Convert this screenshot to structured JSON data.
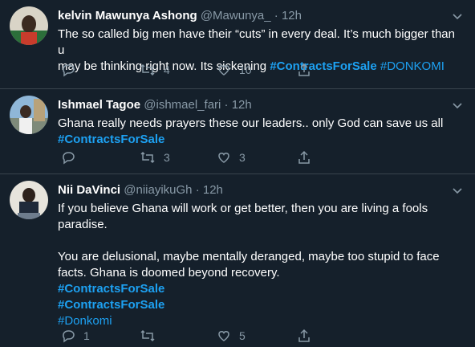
{
  "tweets": [
    {
      "name": "kelvin Mawunya Ashong",
      "handle": "@Mawunya_",
      "sep": "·",
      "time": "12h",
      "line1": "The so called big men have their “cuts” in every deal. It’s much bigger than u",
      "line2_text": "may be thinking right now. Its sickening ",
      "tag1": "#ContractsForSale",
      "tag2": "#DONKOMI",
      "replies": "",
      "retweets": "4",
      "likes": "10"
    },
    {
      "name": "Ishmael Tagoe",
      "handle": "@ishmael_fari",
      "sep": "·",
      "time": "12h",
      "line1": "Ghana really needs prayers these  our leaders.. only God can save us all",
      "tag1": "#ContractsForSale",
      "replies": "",
      "retweets": "3",
      "likes": "3"
    },
    {
      "name": "Nii DaVinci",
      "handle": "@niiayikuGh",
      "sep": "·",
      "time": "12h",
      "line1": "If you believe Ghana will work or get better, then you are living a fools",
      "line2": "paradise.",
      "line3": "You are delusional, maybe mentally deranged, maybe too stupid to face",
      "line4": "facts. Ghana is doomed beyond recovery.",
      "tag1": "#ContractsForSale",
      "tag2": "#ContractsForSale",
      "tag3": "#Donkomi",
      "replies": "1",
      "retweets": "",
      "likes": "5"
    }
  ],
  "colors": {
    "background": "#15202b",
    "divider": "#38444d",
    "secondary_text": "#8899a6",
    "link": "#1da1f2"
  },
  "icons": [
    "reply-icon",
    "retweet-icon",
    "like-icon",
    "share-icon",
    "caret-down-icon"
  ]
}
